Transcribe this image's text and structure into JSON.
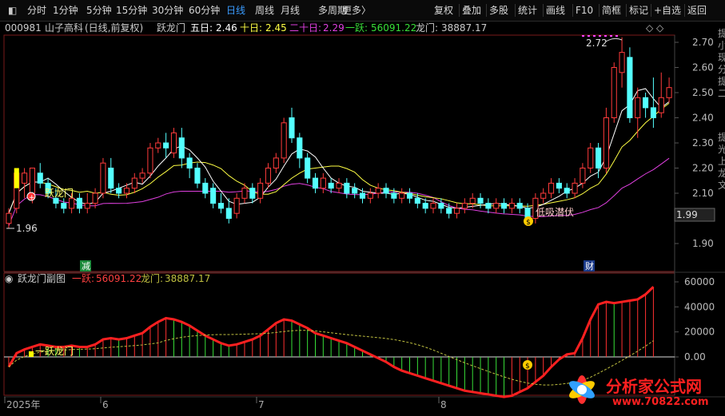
{
  "toolbar": {
    "left": [
      {
        "label": "分时",
        "active": false
      },
      {
        "label": "1分钟",
        "active": false
      },
      {
        "label": "5分钟",
        "active": false
      },
      {
        "label": "15分钟",
        "active": false
      },
      {
        "label": "30分钟",
        "active": false
      },
      {
        "label": "60分钟",
        "active": false
      },
      {
        "label": "日线",
        "active": true
      },
      {
        "label": "周线",
        "active": false
      },
      {
        "label": "月线",
        "active": false
      },
      {
        "label": "多周期",
        "active": false
      },
      {
        "label": "更多",
        "active": false
      }
    ],
    "more_arrow": "〉",
    "right": [
      "复权",
      "叠加",
      "多股",
      "统计",
      "画线",
      "F10",
      "简框",
      "标记",
      "+自选",
      "返回"
    ]
  },
  "info": {
    "code": "000981",
    "name": "山子高科",
    "mode": "(日线,前复权)",
    "indicator": "跃龙门",
    "ma5_label": "五日:",
    "ma5": "2.46",
    "ma10_label": "十日:",
    "ma10": "2.45",
    "ma20_label": "二十日:",
    "ma20": "2.29",
    "yy_label": "一跃:",
    "yy": "56091.22",
    "lm_label": "龙门:",
    "lm": "38887.17",
    "icons": "◇ ◇"
  },
  "sub": {
    "title": "跃龙门副图",
    "yy_label": "一跃:",
    "yy": "56091.22",
    "lm_label": "龙门:",
    "lm": "38887.17"
  },
  "main_axis": [
    "2.70",
    "2.60",
    "2.50",
    "2.40",
    "2.30",
    "2.20",
    "2.10",
    "2.00",
    "1.90"
  ],
  "price_current": "1.99",
  "sub_axis": [
    "60000",
    "40000",
    "20000",
    "0.00"
  ],
  "date_labels": [
    "2025年",
    "6",
    "7",
    "8"
  ],
  "annotations": {
    "low": "1.96",
    "high": "2.72",
    "yyl": "跃龙门",
    "dxqf": "低吸潜伏",
    "sub_yyl": "一跃龙门",
    "mark_jian": "减",
    "mark_cai": "财",
    "coin": "$"
  },
  "right_edge_text": [
    "提",
    "小",
    "现",
    "分",
    "提",
    "二",
    "提",
    "光",
    "上",
    "龙",
    "文"
  ],
  "watermark": {
    "title": "分析家公式网",
    "url": "www.70822.com"
  },
  "colors": {
    "up": "#ff3b3b",
    "down": "#54ffff",
    "ma5": "#ffffff",
    "ma10": "#ffff44",
    "ma20": "#e040e0",
    "accent": "#3a9cff"
  },
  "chart_data": {
    "type": "candlestick",
    "candles": [
      [
        1.98,
        2.02,
        1.96,
        2.04
      ],
      [
        2.04,
        2.18,
        2.02,
        2.2
      ],
      [
        2.14,
        2.18,
        2.08,
        2.2
      ],
      [
        2.1,
        2.2,
        2.06,
        2.2
      ],
      [
        2.18,
        2.14,
        2.12,
        2.22
      ],
      [
        2.14,
        2.1,
        2.08,
        2.16
      ],
      [
        2.08,
        2.06,
        2.04,
        2.12
      ],
      [
        2.06,
        2.04,
        2.02,
        2.08
      ],
      [
        2.04,
        2.08,
        2.02,
        2.1
      ],
      [
        2.08,
        2.04,
        2.02,
        2.1
      ],
      [
        2.04,
        2.06,
        2.02,
        2.1
      ],
      [
        2.06,
        2.1,
        2.04,
        2.12
      ],
      [
        2.1,
        2.22,
        2.08,
        2.24
      ],
      [
        2.2,
        2.12,
        2.1,
        2.24
      ],
      [
        2.12,
        2.1,
        2.08,
        2.14
      ],
      [
        2.1,
        2.12,
        2.08,
        2.14
      ],
      [
        2.12,
        2.16,
        2.1,
        2.18
      ],
      [
        2.16,
        2.18,
        2.14,
        2.2
      ],
      [
        2.18,
        2.28,
        2.16,
        2.3
      ],
      [
        2.28,
        2.3,
        2.26,
        2.32
      ],
      [
        2.3,
        2.28,
        2.24,
        2.34
      ],
      [
        2.26,
        2.34,
        2.24,
        2.36
      ],
      [
        2.32,
        2.24,
        2.2,
        2.36
      ],
      [
        2.24,
        2.2,
        2.16,
        2.26
      ],
      [
        2.2,
        2.14,
        2.12,
        2.22
      ],
      [
        2.14,
        2.1,
        2.08,
        2.16
      ],
      [
        2.12,
        2.06,
        2.04,
        2.14
      ],
      [
        2.06,
        2.04,
        2.02,
        2.1
      ],
      [
        2.04,
        2.0,
        1.98,
        2.08
      ],
      [
        2.02,
        2.08,
        2.0,
        2.1
      ],
      [
        2.08,
        2.12,
        2.06,
        2.14
      ],
      [
        2.12,
        2.08,
        2.06,
        2.14
      ],
      [
        2.08,
        2.14,
        2.06,
        2.16
      ],
      [
        2.14,
        2.2,
        2.12,
        2.22
      ],
      [
        2.2,
        2.24,
        2.18,
        2.26
      ],
      [
        2.24,
        2.38,
        2.22,
        2.4
      ],
      [
        2.4,
        2.32,
        2.3,
        2.44
      ],
      [
        2.32,
        2.24,
        2.2,
        2.34
      ],
      [
        2.24,
        2.16,
        2.14,
        2.26
      ],
      [
        2.16,
        2.12,
        2.1,
        2.18
      ],
      [
        2.12,
        2.16,
        2.1,
        2.18
      ],
      [
        2.14,
        2.12,
        2.1,
        2.16
      ],
      [
        2.12,
        2.14,
        2.1,
        2.16
      ],
      [
        2.14,
        2.1,
        2.08,
        2.16
      ],
      [
        2.12,
        2.1,
        2.08,
        2.14
      ],
      [
        2.1,
        2.08,
        2.06,
        2.12
      ],
      [
        2.08,
        2.1,
        2.06,
        2.12
      ],
      [
        2.1,
        2.12,
        2.08,
        2.14
      ],
      [
        2.12,
        2.1,
        2.08,
        2.14
      ],
      [
        2.1,
        2.08,
        2.06,
        2.12
      ],
      [
        2.08,
        2.1,
        2.06,
        2.12
      ],
      [
        2.1,
        2.08,
        2.06,
        2.12
      ],
      [
        2.08,
        2.06,
        2.04,
        2.1
      ],
      [
        2.06,
        2.04,
        2.02,
        2.08
      ],
      [
        2.04,
        2.06,
        2.02,
        2.08
      ],
      [
        2.06,
        2.04,
        2.02,
        2.08
      ],
      [
        2.04,
        2.02,
        2.0,
        2.06
      ],
      [
        2.02,
        2.04,
        2.0,
        2.06
      ],
      [
        2.04,
        2.06,
        2.02,
        2.08
      ],
      [
        2.06,
        2.08,
        2.04,
        2.1
      ],
      [
        2.08,
        2.06,
        2.04,
        2.1
      ],
      [
        2.06,
        2.04,
        2.02,
        2.08
      ],
      [
        2.04,
        2.06,
        2.02,
        2.08
      ],
      [
        2.06,
        2.04,
        2.02,
        2.08
      ],
      [
        2.04,
        2.06,
        2.02,
        2.08
      ],
      [
        2.06,
        2.04,
        2.02,
        2.08
      ],
      [
        2.04,
        2.0,
        1.98,
        2.06
      ],
      [
        2.0,
        2.08,
        1.98,
        2.1
      ],
      [
        2.08,
        2.1,
        2.06,
        2.12
      ],
      [
        2.1,
        2.14,
        2.08,
        2.16
      ],
      [
        2.14,
        2.12,
        2.1,
        2.16
      ],
      [
        2.12,
        2.1,
        2.08,
        2.14
      ],
      [
        2.1,
        2.14,
        2.08,
        2.16
      ],
      [
        2.14,
        2.2,
        2.12,
        2.22
      ],
      [
        2.2,
        2.28,
        2.18,
        2.3
      ],
      [
        2.28,
        2.2,
        2.16,
        2.3
      ],
      [
        2.2,
        2.4,
        2.18,
        2.44
      ],
      [
        2.4,
        2.6,
        2.38,
        2.62
      ],
      [
        2.58,
        2.66,
        2.52,
        2.72
      ],
      [
        2.64,
        2.4,
        2.38,
        2.68
      ],
      [
        2.4,
        2.48,
        2.32,
        2.52
      ],
      [
        2.48,
        2.44,
        2.4,
        2.5
      ],
      [
        2.44,
        2.4,
        2.36,
        2.56
      ],
      [
        2.42,
        2.48,
        2.4,
        2.58
      ],
      [
        2.48,
        2.52,
        2.46,
        2.56
      ]
    ],
    "yy": [
      -8000,
      3000,
      6000,
      8000,
      10000,
      9000,
      8000,
      8000,
      9000,
      8000,
      8000,
      10000,
      14000,
      15000,
      14000,
      15000,
      17000,
      19000,
      24000,
      28000,
      31000,
      30000,
      28000,
      25000,
      21000,
      17000,
      14000,
      11000,
      9000,
      10000,
      12000,
      14000,
      17000,
      22000,
      27000,
      30000,
      29000,
      26000,
      23000,
      19000,
      17000,
      15000,
      13000,
      11000,
      8000,
      5000,
      2000,
      -1000,
      -4000,
      -8000,
      -11000,
      -13000,
      -15000,
      -17000,
      -19000,
      -21000,
      -23000,
      -25000,
      -27000,
      -28000,
      -29000,
      -30000,
      -31000,
      -32000,
      -31000,
      -28000,
      -25000,
      -20000,
      -15000,
      -8000,
      -2000,
      2000,
      3000,
      15000,
      30000,
      42000,
      44000,
      43000,
      44000,
      45000,
      46000,
      50000,
      56000
    ]
  }
}
